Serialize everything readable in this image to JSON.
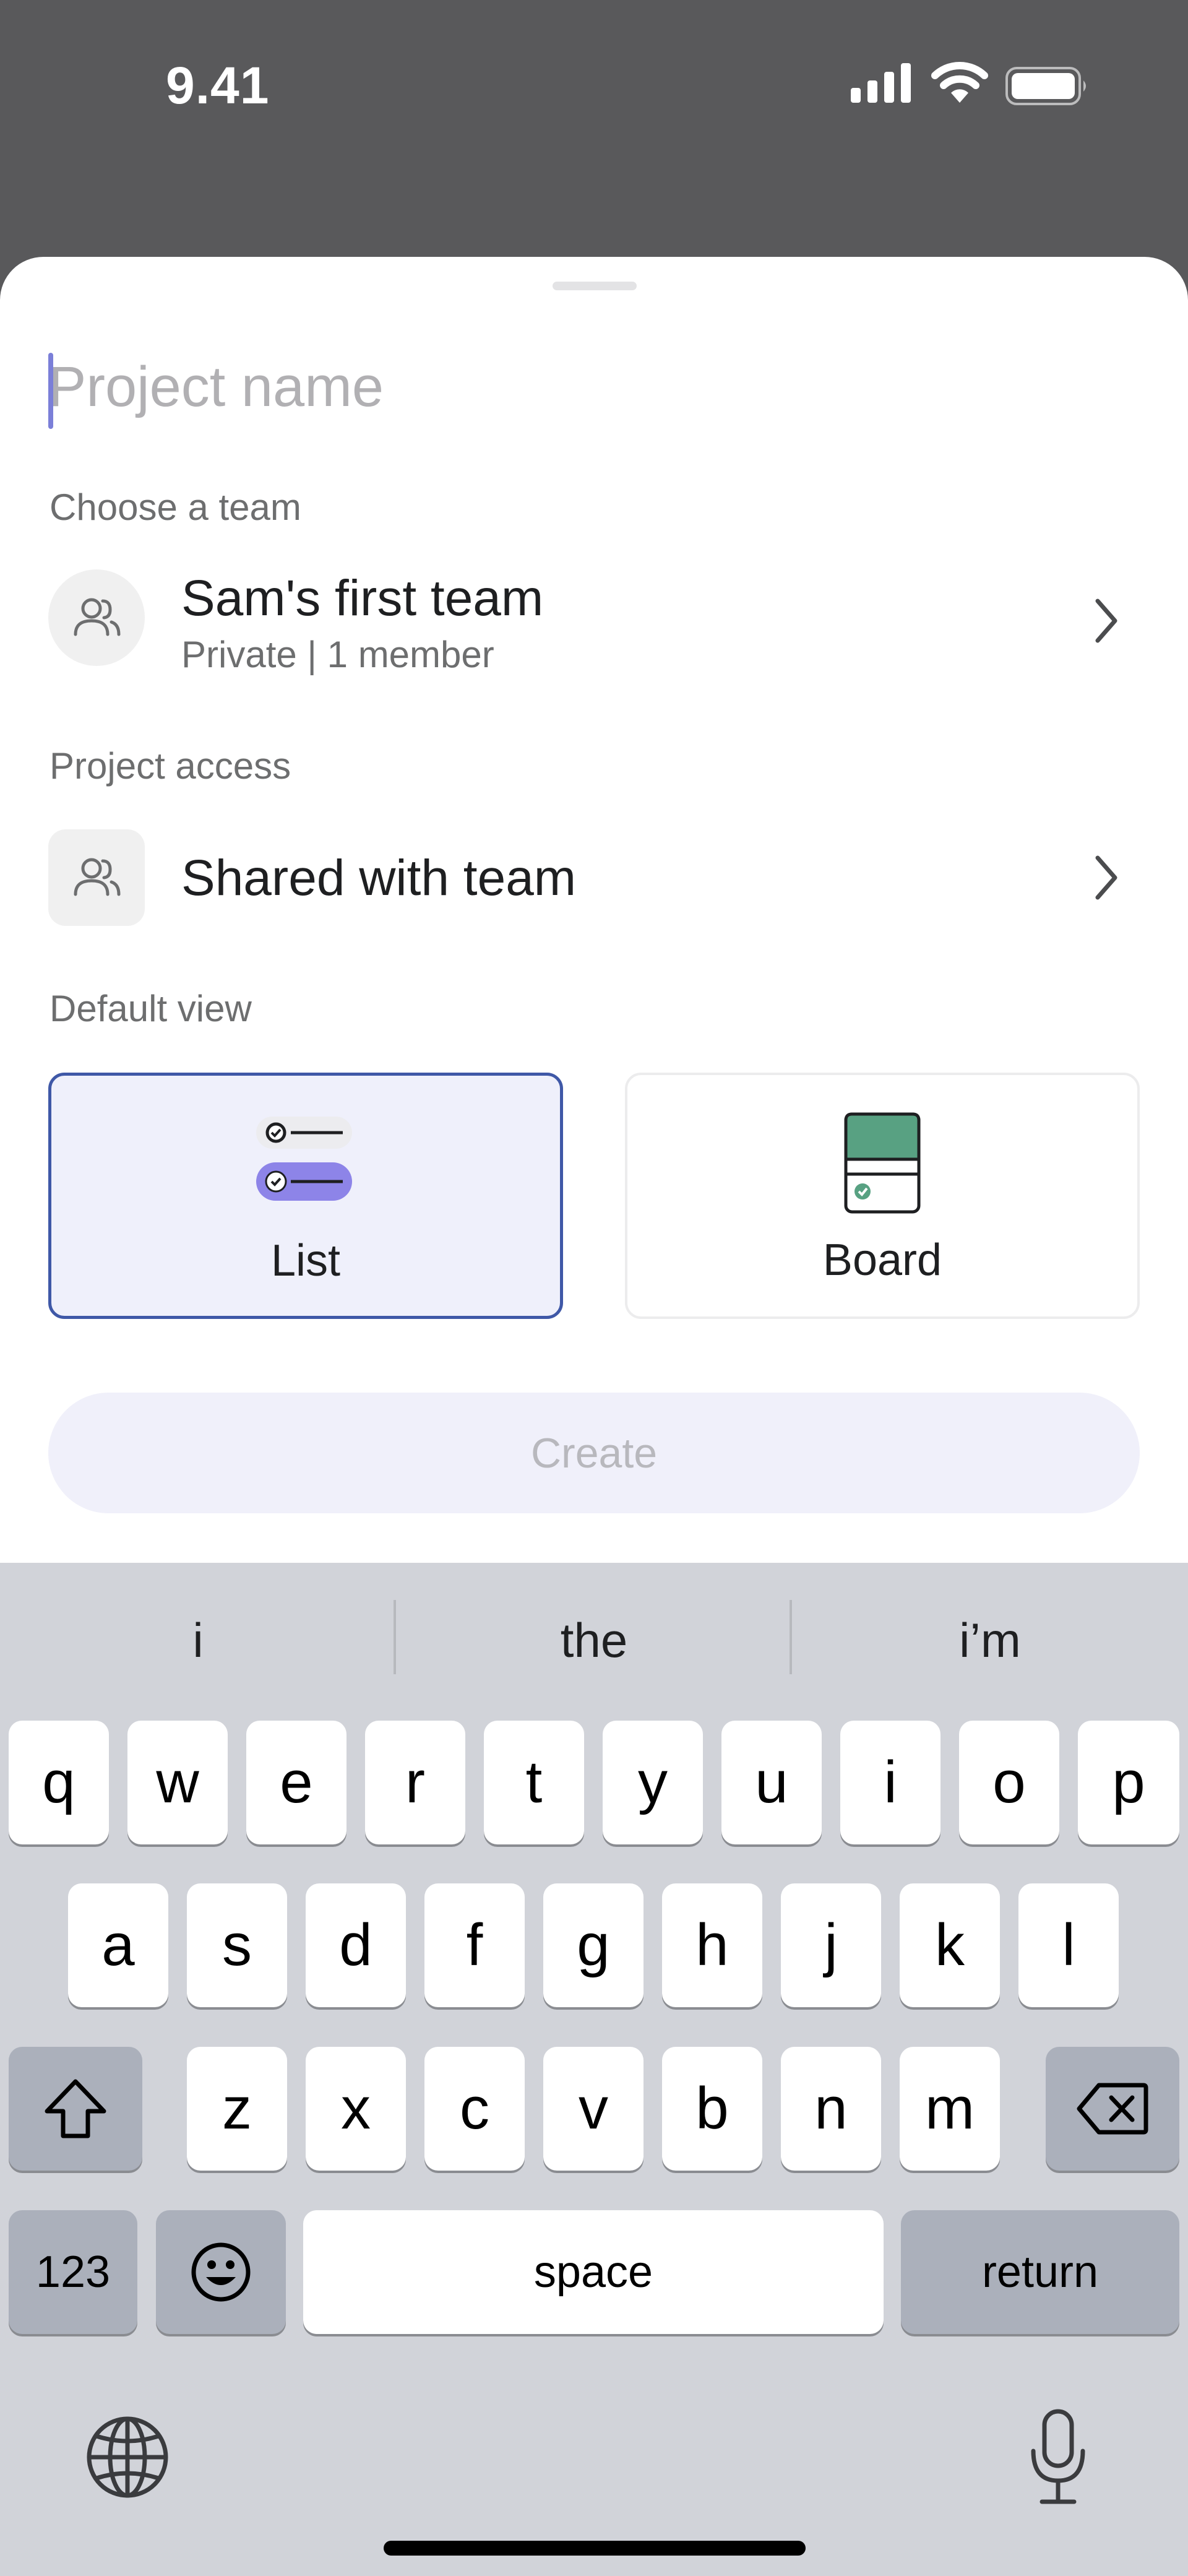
{
  "status_bar": {
    "time": "9.41"
  },
  "form": {
    "project_name_placeholder": "Project name",
    "team_section_label": "Choose a team",
    "team_name": "Sam's first team",
    "team_meta": "Private | 1 member",
    "access_section_label": "Project access",
    "access_value": "Shared with team",
    "view_section_label": "Default view",
    "views": [
      {
        "label": "List",
        "selected": true
      },
      {
        "label": "Board",
        "selected": false
      }
    ],
    "create_label": "Create"
  },
  "colors": {
    "accent": "#3f58a7",
    "selected_card_bg": "#eff0fb",
    "list_pill": "#8d84e8",
    "board_green": "#58a182"
  },
  "keyboard": {
    "suggestions": [
      "i",
      "the",
      "i’m"
    ],
    "row1": [
      "q",
      "w",
      "e",
      "r",
      "t",
      "y",
      "u",
      "i",
      "o",
      "p"
    ],
    "row2": [
      "a",
      "s",
      "d",
      "f",
      "g",
      "h",
      "j",
      "k",
      "l"
    ],
    "row3": [
      "z",
      "x",
      "c",
      "v",
      "b",
      "n",
      "m"
    ],
    "numbers_label": "123",
    "space_label": "space",
    "return_label": "return"
  }
}
